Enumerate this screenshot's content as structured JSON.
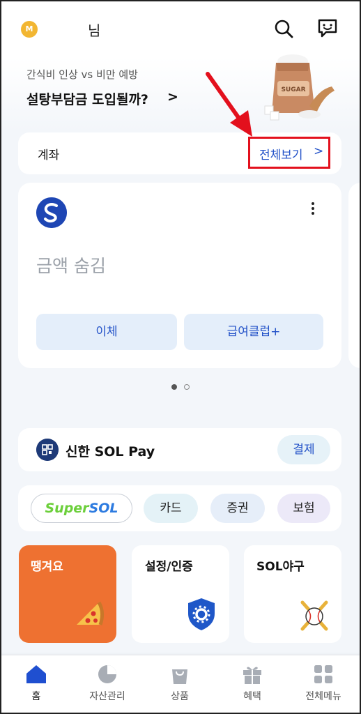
{
  "header": {
    "badge_letter": "M",
    "user_suffix": "님",
    "icons": [
      "search-icon",
      "chat-icon"
    ]
  },
  "promo": {
    "subtitle": "간식비 인상 vs 비만 예방",
    "title": "설탕부담금 도입될까?",
    "chevron": ">",
    "image_text": "SUGAR"
  },
  "account": {
    "label": "계좌",
    "view_all": "전체보기",
    "view_all_chevron": ">",
    "hidden_amount": "금액 숨김",
    "transfer_button": "이체",
    "salary_button": "급여클럽+",
    "page_count": 2,
    "active_page": 1
  },
  "sol_pay": {
    "title": "신한 SOL Pay",
    "pay_button": "결제"
  },
  "pills": {
    "supersol_a": "Super",
    "supersol_b": "SOL",
    "card": "카드",
    "securities": "증권",
    "insurance": "보험"
  },
  "tiles": {
    "bonus": "땡겨요",
    "settings": "설정/인증",
    "baseball": "SOL야구"
  },
  "bottom_nav": {
    "items": [
      {
        "label": "홈",
        "icon": "home-icon",
        "active": true
      },
      {
        "label": "자산관리",
        "icon": "pie-chart-icon",
        "active": false
      },
      {
        "label": "상품",
        "icon": "shopping-bag-icon",
        "active": false
      },
      {
        "label": "혜택",
        "icon": "gift-icon",
        "active": false
      },
      {
        "label": "전체메뉴",
        "icon": "grid-menu-icon",
        "active": false
      }
    ]
  },
  "colors": {
    "accent_blue": "#2352c8",
    "annotation_red": "#e3101d",
    "tile_orange": "#ee7131",
    "badge_gold": "#f2b632"
  }
}
